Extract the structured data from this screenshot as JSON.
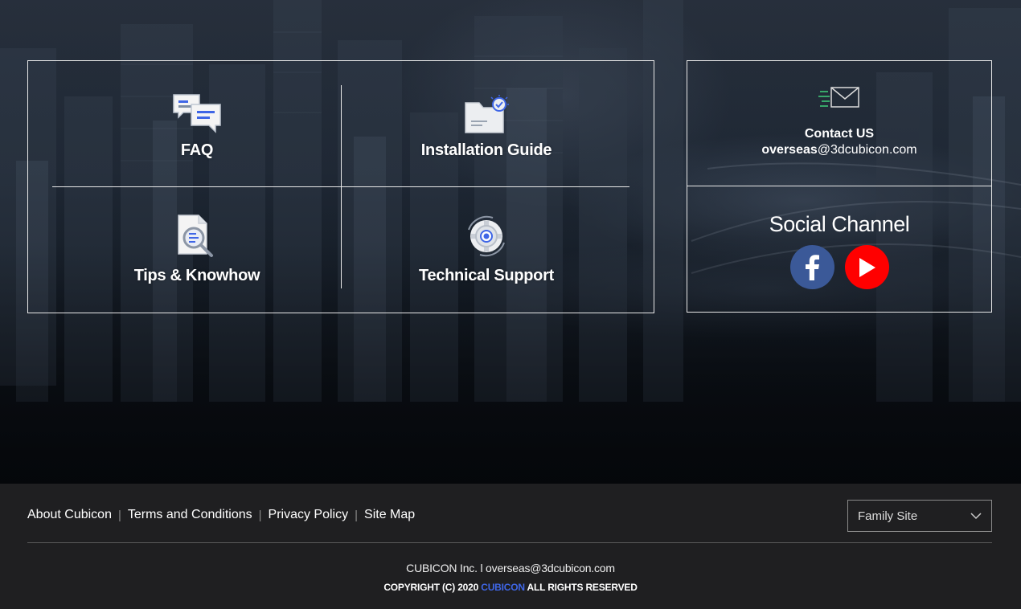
{
  "tiles": [
    {
      "label": "FAQ",
      "icon": "faq-chat-icon"
    },
    {
      "label": "Installation Guide",
      "icon": "folder-check-icon"
    },
    {
      "label": "Tips & Knowhow",
      "icon": "document-search-icon"
    },
    {
      "label": "Technical Support",
      "icon": "gear-icon"
    }
  ],
  "contact": {
    "icon": "mail-icon",
    "title": "Contact US",
    "email_bold": "overseas",
    "email_rest": "@3dcubicon.com"
  },
  "social": {
    "title": "Social Channel",
    "facebook_icon": "facebook-icon",
    "youtube_icon": "youtube-icon"
  },
  "footer": {
    "links": [
      "About Cubicon",
      "Terms and Conditions",
      "Privacy Policy",
      "Site Map"
    ],
    "separator": "|",
    "family_site": "Family Site",
    "company_line": "CUBICON Inc. l overseas@3dcubicon.com",
    "copyright_prefix": "COPYRIGHT (C) 2020",
    "copyright_brand": "CUBICON",
    "copyright_suffix": "ALL RIGHTS RESERVED"
  },
  "colors": {
    "accent_blue": "#3f66e6",
    "facebook": "#3b5998",
    "youtube": "#ff0000",
    "footer_bg": "#1f1f21"
  }
}
